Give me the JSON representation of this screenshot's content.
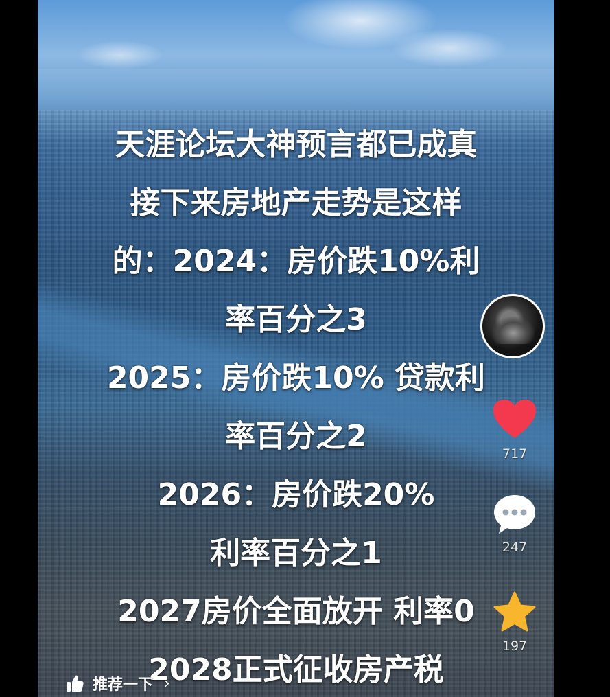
{
  "caption": {
    "lines": [
      "天涯论坛大神预言都已成真",
      "接下来房地产走势是这样",
      "的：2024：房价跌10%利",
      "率百分之3",
      "2025：房价跌10% 贷款利",
      "率百分之2",
      "2026：房价跌20%",
      "利率百分之1",
      "2027房价全面放开 利率0",
      "2028正式征收房产税"
    ]
  },
  "actions": {
    "like_count": "717",
    "comment_count": "247",
    "favorite_count": "197"
  },
  "bottom": {
    "recommend_label": "推荐一下",
    "chevron": "›"
  },
  "colors": {
    "heart": "#f2394e",
    "star": "#f7b62b",
    "comment": "#ffffff"
  },
  "icons": {
    "like": "heart-icon",
    "comment": "comment-bubble-icon",
    "favorite": "star-icon",
    "recommend": "thumbs-up-icon"
  }
}
